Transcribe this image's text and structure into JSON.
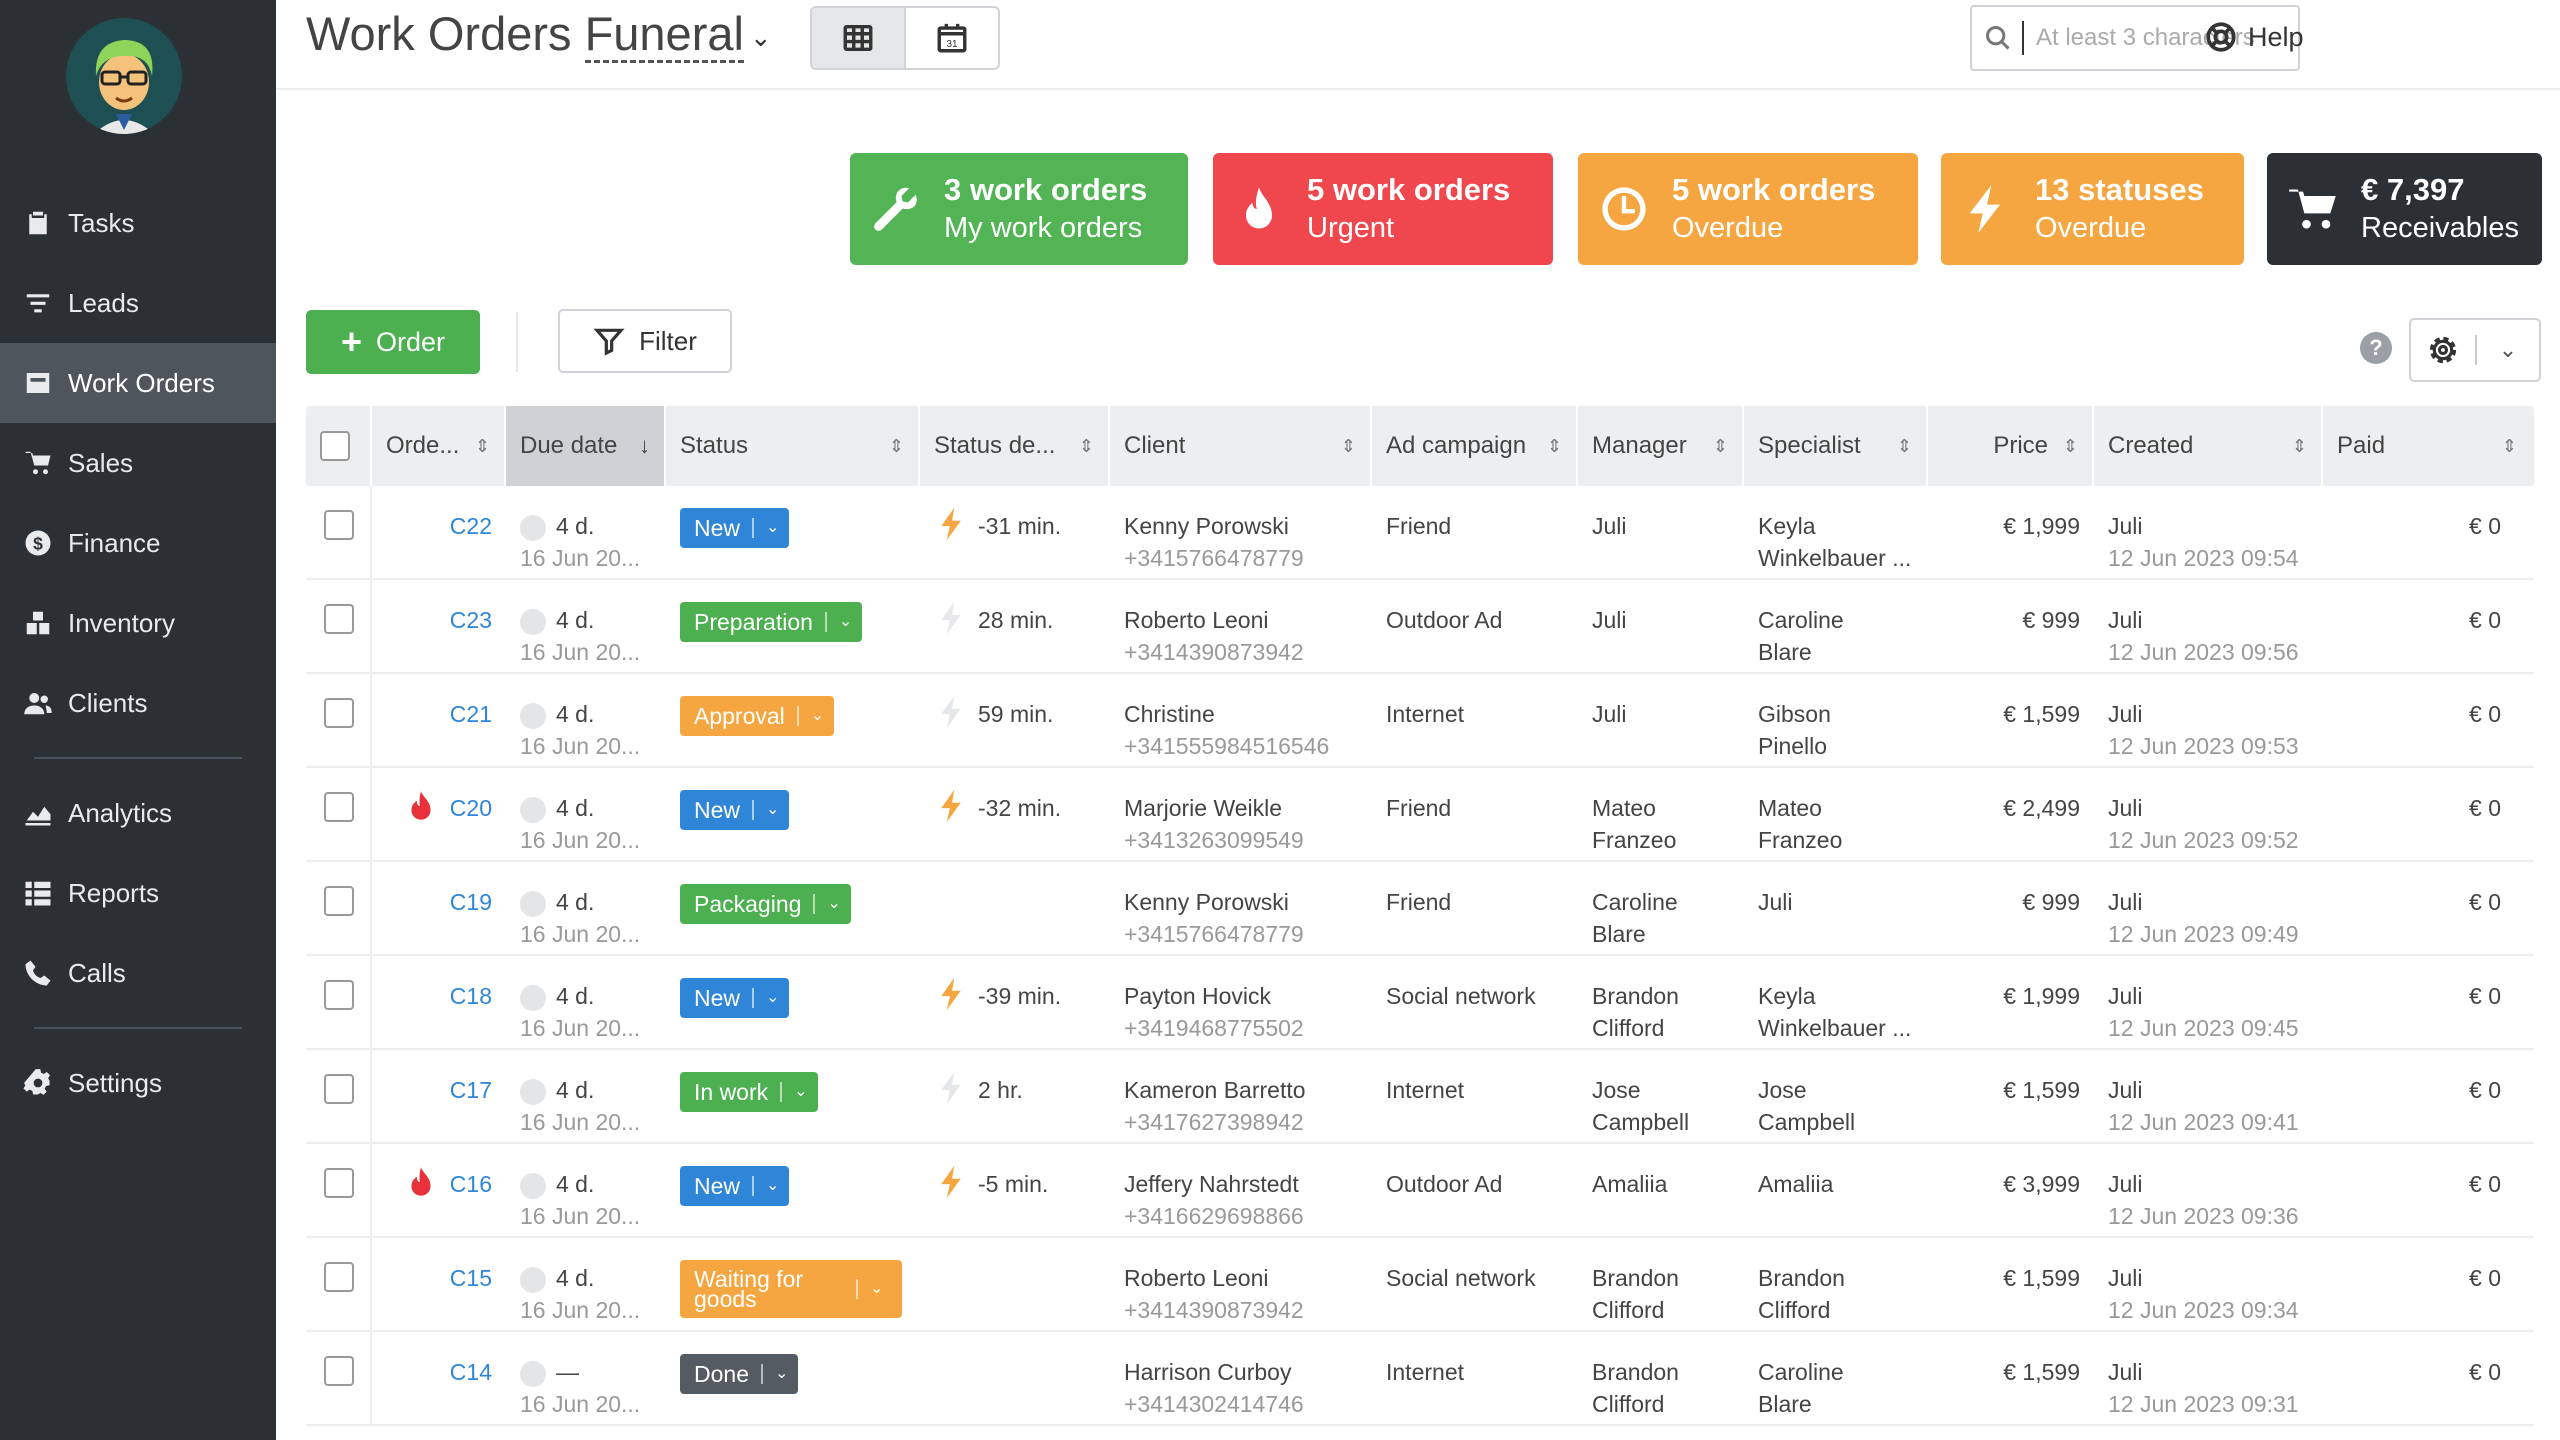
{
  "header": {
    "title": "Work Orders",
    "subtitle": "Funeral",
    "search_placeholder": "At least 3 characters",
    "help_label": "Help"
  },
  "sidebar": {
    "items": [
      {
        "label": "Tasks",
        "icon": "clipboard-icon"
      },
      {
        "label": "Leads",
        "icon": "funnel-icon"
      },
      {
        "label": "Work Orders",
        "icon": "work-orders-icon",
        "active": true
      },
      {
        "label": "Sales",
        "icon": "cart-icon"
      },
      {
        "label": "Finance",
        "icon": "dollar-icon"
      },
      {
        "label": "Inventory",
        "icon": "boxes-icon"
      },
      {
        "label": "Clients",
        "icon": "users-icon"
      },
      {
        "label": "Analytics",
        "icon": "chart-icon"
      },
      {
        "label": "Reports",
        "icon": "list-icon"
      },
      {
        "label": "Calls",
        "icon": "phone-icon"
      },
      {
        "label": "Settings",
        "icon": "gear-icon"
      }
    ]
  },
  "tiles": [
    {
      "line1": "3 work orders",
      "line2": "My work orders",
      "color": "#52b454",
      "icon": "wrench-icon"
    },
    {
      "line1": "5 work orders",
      "line2": "Urgent",
      "color": "#f0474f",
      "icon": "flame-icon"
    },
    {
      "line1": "5 work orders",
      "line2": "Overdue",
      "color": "#f5a640",
      "icon": "clock-icon"
    },
    {
      "line1": "13 statuses",
      "line2": "Overdue",
      "color": "#f5a640",
      "icon": "bolt-icon"
    },
    {
      "line1": "€ 7,397",
      "line2": "Receivables",
      "color": "#2b3035",
      "icon": "cart-icon"
    }
  ],
  "toolbar": {
    "order_label": "Order",
    "filter_label": "Filter",
    "help_mark": "?"
  },
  "columns": [
    "Orde...",
    "Due date",
    "Status",
    "Status de...",
    "Client",
    "Ad campaign",
    "Manager",
    "Specialist",
    "Price",
    "Created",
    "Paid"
  ],
  "status_colors": {
    "New": "#2f85d8",
    "Preparation": "#4caf50",
    "Approval": "#f5a640",
    "Packaging": "#4caf50",
    "In work": "#4caf50",
    "Waiting for goods": "#f5a640",
    "Done": "#545b62"
  },
  "rows": [
    {
      "order": "C22",
      "urgent": false,
      "due": "4 d.",
      "due_date": "16 Jun 20...",
      "status": "New",
      "status_color": "#2f85d8",
      "bolt": "orange",
      "status_deadline": "-31 min.",
      "client": "Kenny Porowski",
      "phone": "+3415766478779",
      "ad": "Friend",
      "manager1": "Juli",
      "manager2": "",
      "specialist1": "Keyla",
      "specialist2": "Winkelbauer ...",
      "price": "€ 1,999",
      "created_by": "Juli",
      "created_at": "12 Jun 2023 09:54",
      "paid": "€ 0"
    },
    {
      "order": "C23",
      "urgent": false,
      "due": "4 d.",
      "due_date": "16 Jun 20...",
      "status": "Preparation",
      "status_color": "#4caf50",
      "bolt": "gray",
      "status_deadline": "28 min.",
      "client": "Roberto Leoni",
      "phone": "+3414390873942",
      "ad": "Outdoor Ad",
      "manager1": "Juli",
      "manager2": "",
      "specialist1": "Caroline",
      "specialist2": "Blare",
      "price": "€ 999",
      "created_by": "Juli",
      "created_at": "12 Jun 2023 09:56",
      "paid": "€ 0"
    },
    {
      "order": "C21",
      "urgent": false,
      "due": "4 d.",
      "due_date": "16 Jun 20...",
      "status": "Approval",
      "status_color": "#f5a640",
      "bolt": "gray",
      "status_deadline": "59 min.",
      "client": "Christine",
      "phone": "+341555984516546",
      "ad": "Internet",
      "manager1": "Juli",
      "manager2": "",
      "specialist1": "Gibson",
      "specialist2": "Pinello",
      "price": "€ 1,599",
      "created_by": "Juli",
      "created_at": "12 Jun 2023 09:53",
      "paid": "€ 0"
    },
    {
      "order": "C20",
      "urgent": true,
      "due": "4 d.",
      "due_date": "16 Jun 20...",
      "status": "New",
      "status_color": "#2f85d8",
      "bolt": "orange",
      "status_deadline": "-32 min.",
      "client": "Marjorie Weikle",
      "phone": "+3413263099549",
      "ad": "Friend",
      "manager1": "Mateo",
      "manager2": "Franzeo",
      "specialist1": "Mateo",
      "specialist2": "Franzeo",
      "price": "€ 2,499",
      "created_by": "Juli",
      "created_at": "12 Jun 2023 09:52",
      "paid": "€ 0"
    },
    {
      "order": "C19",
      "urgent": false,
      "due": "4 d.",
      "due_date": "16 Jun 20...",
      "status": "Packaging",
      "status_color": "#4caf50",
      "bolt": "",
      "status_deadline": "",
      "client": "Kenny Porowski",
      "phone": "+3415766478779",
      "ad": "Friend",
      "manager1": "Caroline",
      "manager2": "Blare",
      "specialist1": "Juli",
      "specialist2": "",
      "price": "€ 999",
      "created_by": "Juli",
      "created_at": "12 Jun 2023 09:49",
      "paid": "€ 0"
    },
    {
      "order": "C18",
      "urgent": false,
      "due": "4 d.",
      "due_date": "16 Jun 20...",
      "status": "New",
      "status_color": "#2f85d8",
      "bolt": "orange",
      "status_deadline": "-39 min.",
      "client": "Payton Hovick",
      "phone": "+3419468775502",
      "ad": "Social network",
      "manager1": "Brandon",
      "manager2": "Clifford",
      "specialist1": "Keyla",
      "specialist2": "Winkelbauer ...",
      "price": "€ 1,999",
      "created_by": "Juli",
      "created_at": "12 Jun 2023 09:45",
      "paid": "€ 0"
    },
    {
      "order": "C17",
      "urgent": false,
      "due": "4 d.",
      "due_date": "16 Jun 20...",
      "status": "In work",
      "status_color": "#4caf50",
      "bolt": "gray",
      "status_deadline": "2 hr.",
      "client": "Kameron Barretto",
      "phone": "+3417627398942",
      "ad": "Internet",
      "manager1": "Jose",
      "manager2": "Campbell",
      "specialist1": "Jose",
      "specialist2": "Campbell",
      "price": "€ 1,599",
      "created_by": "Juli",
      "created_at": "12 Jun 2023 09:41",
      "paid": "€ 0"
    },
    {
      "order": "C16",
      "urgent": true,
      "due": "4 d.",
      "due_date": "16 Jun 20...",
      "status": "New",
      "status_color": "#2f85d8",
      "bolt": "orange",
      "status_deadline": "-5 min.",
      "client": "Jeffery Nahrstedt",
      "phone": "+3416629698866",
      "ad": "Outdoor Ad",
      "manager1": "Amaliia",
      "manager2": "",
      "specialist1": "Amaliia",
      "specialist2": "",
      "price": "€ 3,999",
      "created_by": "Juli",
      "created_at": "12 Jun 2023 09:36",
      "paid": "€ 0"
    },
    {
      "order": "C15",
      "urgent": false,
      "due": "4 d.",
      "due_date": "16 Jun 20...",
      "status": "Waiting for goods",
      "status_color": "#f5a640",
      "bolt": "",
      "status_deadline": "",
      "client": "Roberto Leoni",
      "phone": "+3414390873942",
      "ad": "Social network",
      "manager1": "Brandon",
      "manager2": "Clifford",
      "specialist1": "Brandon",
      "specialist2": "Clifford",
      "price": "€ 1,599",
      "created_by": "Juli",
      "created_at": "12 Jun 2023 09:34",
      "paid": "€ 0"
    },
    {
      "order": "C14",
      "urgent": false,
      "due": "—",
      "due_date": "16 Jun 20...",
      "status": "Done",
      "status_color": "#545b62",
      "bolt": "",
      "status_deadline": "",
      "client": "Harrison Curboy",
      "phone": "+3414302414746",
      "ad": "Internet",
      "manager1": "Brandon",
      "manager2": "Clifford",
      "specialist1": "Caroline",
      "specialist2": "Blare",
      "price": "€ 1,599",
      "created_by": "Juli",
      "created_at": "12 Jun 2023 09:31",
      "paid": "€ 0"
    }
  ]
}
